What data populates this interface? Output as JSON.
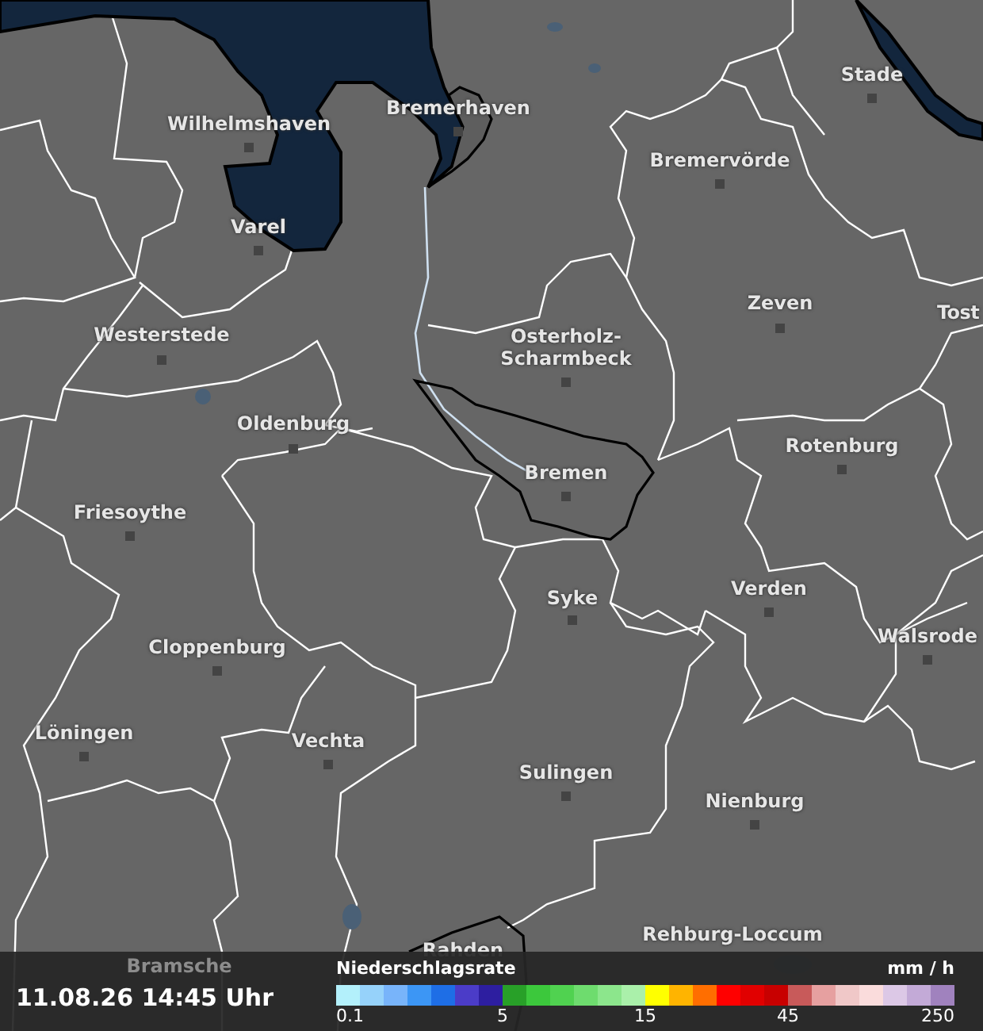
{
  "map": {
    "places": [
      {
        "name": "Stade"
      },
      {
        "name": "Bremerhaven"
      },
      {
        "name": "Wilhelmshaven"
      },
      {
        "name": "Bremervörde"
      },
      {
        "name": "Varel"
      },
      {
        "name": "Zeven"
      },
      {
        "name": "Tost"
      },
      {
        "name": "Westerstede"
      },
      {
        "name": "Osterholz-Scharmbeck"
      },
      {
        "name": "Oldenburg"
      },
      {
        "name": "Rotenburg"
      },
      {
        "name": "Bremen"
      },
      {
        "name": "Friesoythe"
      },
      {
        "name": "Verden"
      },
      {
        "name": "Syke"
      },
      {
        "name": "Walsrode"
      },
      {
        "name": "Cloppenburg"
      },
      {
        "name": "Löningen"
      },
      {
        "name": "Vechta"
      },
      {
        "name": "Sulingen"
      },
      {
        "name": "Nienburg"
      },
      {
        "name": "Rehburg-Loccum"
      },
      {
        "name": "Rahden"
      },
      {
        "name": "Bramsche"
      }
    ]
  },
  "timestamp": "11.08.26 14:45 Uhr",
  "legend": {
    "title": "Niederschlagsrate",
    "unit": "mm / h",
    "steps": [
      {
        "color": "#b3f0fb"
      },
      {
        "color": "#96d2fa"
      },
      {
        "color": "#78b4fa"
      },
      {
        "color": "#3c96f5"
      },
      {
        "color": "#1e6ee6"
      },
      {
        "color": "#4b3cc8"
      },
      {
        "color": "#2d1ea0"
      },
      {
        "color": "#28a028"
      },
      {
        "color": "#3cc83c"
      },
      {
        "color": "#50d250"
      },
      {
        "color": "#6edc6e"
      },
      {
        "color": "#8ce68c"
      },
      {
        "color": "#aaf0aa"
      },
      {
        "color": "#ffff00"
      },
      {
        "color": "#ffb400"
      },
      {
        "color": "#ff6e00"
      },
      {
        "color": "#ff0000"
      },
      {
        "color": "#e10000"
      },
      {
        "color": "#c80000"
      },
      {
        "color": "#c85a5a"
      },
      {
        "color": "#e6a0a0"
      },
      {
        "color": "#f0c8c8"
      },
      {
        "color": "#fadcdc"
      },
      {
        "color": "#dcc8e6"
      },
      {
        "color": "#c3aad7"
      },
      {
        "color": "#a082be"
      }
    ],
    "ticks": [
      "0.1",
      "5",
      "15",
      "45",
      "250"
    ]
  }
}
